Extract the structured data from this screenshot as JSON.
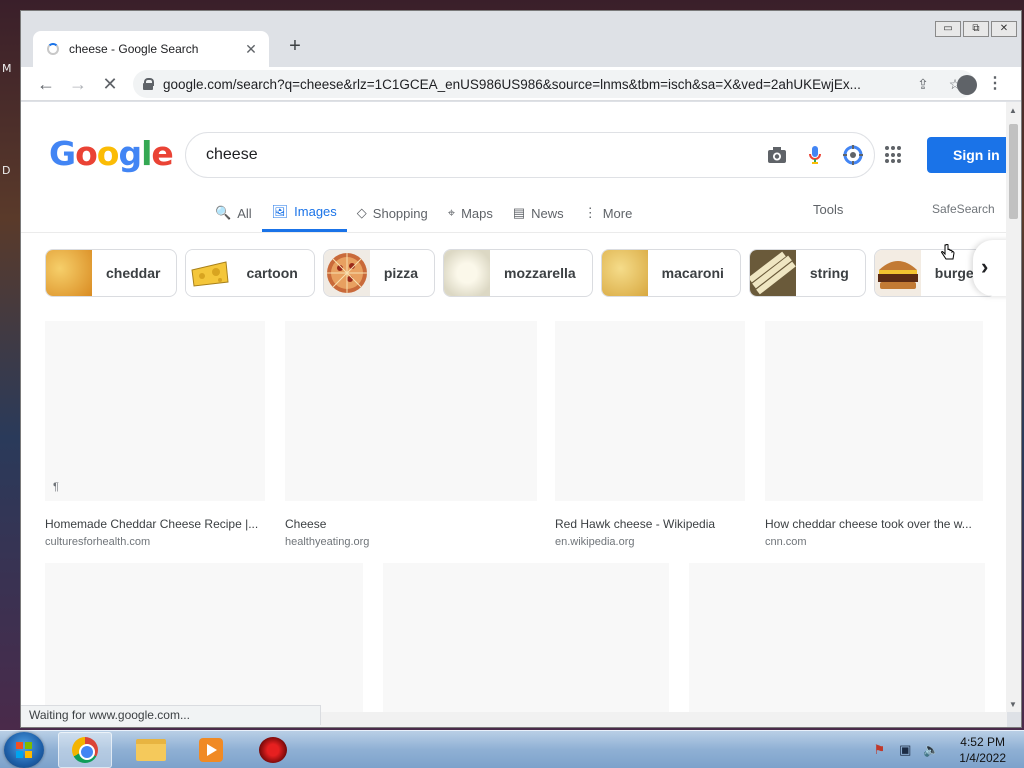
{
  "window": {
    "controls": [
      "▭",
      "⧉",
      "✕"
    ]
  },
  "tab": {
    "title": "cheese - Google Search",
    "close": "✕",
    "new_tab": "+"
  },
  "toolbar": {
    "back": "←",
    "forward": "→",
    "stop": "✕",
    "url": "google.com/search?q=cheese&rlz=1C1GCEA_enUS986US986&source=lnms&tbm=isch&sa=X&ved=2ahUKEwjEx...",
    "share_icon": "⇪",
    "star_icon": "☆",
    "menu_icon": "⋮"
  },
  "google": {
    "logo": [
      "G",
      "o",
      "o",
      "g",
      "l",
      "e"
    ],
    "logo_colors": [
      "#4285f4",
      "#ea4335",
      "#fbbc05",
      "#4285f4",
      "#34a853",
      "#ea4335"
    ],
    "search_query": "cheese",
    "sign_in": "Sign in",
    "tabs": [
      {
        "label": "All",
        "icon": "🔍"
      },
      {
        "label": "Images",
        "icon": "🖼"
      },
      {
        "label": "Shopping",
        "icon": "◇"
      },
      {
        "label": "Maps",
        "icon": "⌖"
      },
      {
        "label": "News",
        "icon": "▤"
      },
      {
        "label": "More",
        "icon": "⋮"
      }
    ],
    "tools": "Tools",
    "safesearch": "SafeSearch"
  },
  "chips": [
    {
      "label": "cheddar",
      "color": "#e6a53a"
    },
    {
      "label": "cartoon",
      "color": "#f3c13a"
    },
    {
      "label": "pizza",
      "color": "#c96a3a"
    },
    {
      "label": "mozzarella",
      "color": "#ece7d6"
    },
    {
      "label": "macaroni",
      "color": "#e8c66a"
    },
    {
      "label": "string",
      "color": "#d8c98a"
    },
    {
      "label": "burger",
      "color": "#8a4a2a"
    }
  ],
  "results": [
    {
      "title": "Homemade Cheddar Cheese Recipe |...",
      "site": "culturesforhealth.com"
    },
    {
      "title": "Cheese",
      "site": "healthyeating.org"
    },
    {
      "title": "Red Hawk cheese - Wikipedia",
      "site": "en.wikipedia.org"
    },
    {
      "title": "How cheddar cheese took over the w...",
      "site": "cnn.com"
    }
  ],
  "status": "Waiting for www.google.com...",
  "desktop": {
    "left_text_1": "M",
    "left_text_2": "D"
  },
  "taskbar": {
    "time": "4:52 PM",
    "date": "1/4/2022"
  }
}
